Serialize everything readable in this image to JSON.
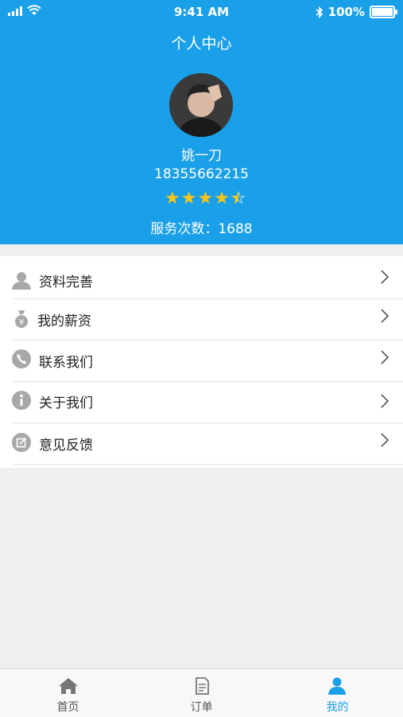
{
  "status_bar": {
    "time": "9:41 AM",
    "battery": "100%"
  },
  "header": {
    "title": "个人中心",
    "user_name": "姚一刀",
    "phone": "18355662215",
    "rating_stars": 4.5,
    "service_count_label": "服务次数：1688"
  },
  "menu": {
    "items": [
      {
        "label": "资料完善",
        "icon": "person-icon"
      },
      {
        "label": "我的薪资",
        "icon": "money-bag-icon"
      },
      {
        "label": "联系我们",
        "icon": "phone-icon"
      },
      {
        "label": "关于我们",
        "icon": "info-icon"
      },
      {
        "label": "意见反馈",
        "icon": "edit-icon"
      }
    ]
  },
  "tabbar": {
    "items": [
      {
        "label": "首页",
        "icon": "home-icon"
      },
      {
        "label": "订单",
        "icon": "document-icon"
      },
      {
        "label": "我的",
        "icon": "user-icon"
      }
    ],
    "active_color": "#1aa0e8"
  },
  "colors": {
    "accent": "#1aa0e8",
    "star": "#f5c518",
    "icon_gray": "#a8a8a8"
  }
}
